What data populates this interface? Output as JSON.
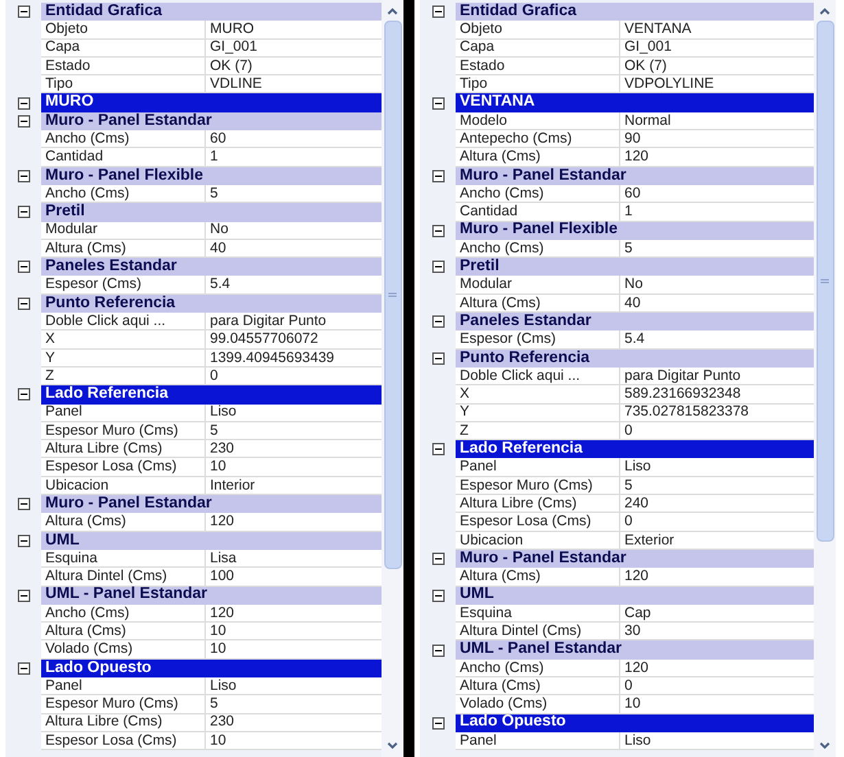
{
  "panels": [
    {
      "rows": [
        {
          "kind": "category",
          "label": "Entidad Grafica",
          "expanded": true,
          "highlighted": false
        },
        {
          "kind": "property",
          "name": "Objeto",
          "value": "MURO"
        },
        {
          "kind": "property",
          "name": "Capa",
          "value": "GI_001"
        },
        {
          "kind": "property",
          "name": "Estado",
          "value": "OK (7)"
        },
        {
          "kind": "property",
          "name": "Tipo",
          "value": "VDLINE"
        },
        {
          "kind": "category",
          "label": "MURO",
          "expanded": true,
          "highlighted": true
        },
        {
          "kind": "category",
          "label": "Muro - Panel Estandar",
          "expanded": true,
          "highlighted": false
        },
        {
          "kind": "property",
          "name": "Ancho (Cms)",
          "value": "60"
        },
        {
          "kind": "property",
          "name": "Cantidad",
          "value": "1"
        },
        {
          "kind": "category",
          "label": "Muro - Panel Flexible",
          "expanded": true,
          "highlighted": false
        },
        {
          "kind": "property",
          "name": "Ancho (Cms)",
          "value": "5"
        },
        {
          "kind": "category",
          "label": "Pretil",
          "expanded": true,
          "highlighted": false
        },
        {
          "kind": "property",
          "name": "Modular",
          "value": "No"
        },
        {
          "kind": "property",
          "name": "Altura (Cms)",
          "value": "40"
        },
        {
          "kind": "category",
          "label": "Paneles Estandar",
          "expanded": true,
          "highlighted": false
        },
        {
          "kind": "property",
          "name": "Espesor (Cms)",
          "value": "5.4"
        },
        {
          "kind": "category",
          "label": "Punto Referencia",
          "expanded": true,
          "highlighted": false
        },
        {
          "kind": "property",
          "name": "Doble Click aqui ...",
          "value": "para Digitar Punto"
        },
        {
          "kind": "property",
          "name": "X",
          "value": "99.04557706072"
        },
        {
          "kind": "property",
          "name": "Y",
          "value": "1399.40945693439"
        },
        {
          "kind": "property",
          "name": "Z",
          "value": "0"
        },
        {
          "kind": "category",
          "label": "Lado Referencia",
          "expanded": true,
          "highlighted": true
        },
        {
          "kind": "property",
          "name": "Panel",
          "value": "Liso"
        },
        {
          "kind": "property",
          "name": "Espesor Muro (Cms)",
          "value": "5"
        },
        {
          "kind": "property",
          "name": "Altura Libre (Cms)",
          "value": "230"
        },
        {
          "kind": "property",
          "name": "Espesor Losa (Cms)",
          "value": "10"
        },
        {
          "kind": "property",
          "name": "Ubicacion",
          "value": "Interior"
        },
        {
          "kind": "category",
          "label": "Muro - Panel Estandar",
          "expanded": true,
          "highlighted": false
        },
        {
          "kind": "property",
          "name": "Altura (Cms)",
          "value": "120"
        },
        {
          "kind": "category",
          "label": "UML",
          "expanded": true,
          "highlighted": false
        },
        {
          "kind": "property",
          "name": "Esquina",
          "value": "Lisa"
        },
        {
          "kind": "property",
          "name": "Altura Dintel (Cms)",
          "value": "100"
        },
        {
          "kind": "category",
          "label": "UML - Panel Estandar",
          "expanded": true,
          "highlighted": false
        },
        {
          "kind": "property",
          "name": "Ancho (Cms)",
          "value": "120"
        },
        {
          "kind": "property",
          "name": "Altura (Cms)",
          "value": "10"
        },
        {
          "kind": "property",
          "name": "Volado (Cms)",
          "value": "10"
        },
        {
          "kind": "category",
          "label": "Lado Opuesto",
          "expanded": true,
          "highlighted": true
        },
        {
          "kind": "property",
          "name": "Panel",
          "value": "Liso"
        },
        {
          "kind": "property",
          "name": "Espesor Muro (Cms)",
          "value": "5"
        },
        {
          "kind": "property",
          "name": "Altura Libre (Cms)",
          "value": "230"
        },
        {
          "kind": "property",
          "name": "Espesor Losa (Cms)",
          "value": "10"
        }
      ]
    },
    {
      "rows": [
        {
          "kind": "category",
          "label": "Entidad Grafica",
          "expanded": true,
          "highlighted": false
        },
        {
          "kind": "property",
          "name": "Objeto",
          "value": "VENTANA"
        },
        {
          "kind": "property",
          "name": "Capa",
          "value": "GI_001"
        },
        {
          "kind": "property",
          "name": "Estado",
          "value": "OK (7)"
        },
        {
          "kind": "property",
          "name": "Tipo",
          "value": "VDPOLYLINE"
        },
        {
          "kind": "category",
          "label": "VENTANA",
          "expanded": true,
          "highlighted": true
        },
        {
          "kind": "property",
          "name": "Modelo",
          "value": "Normal"
        },
        {
          "kind": "property",
          "name": "Antepecho (Cms)",
          "value": "90"
        },
        {
          "kind": "property",
          "name": "Altura (Cms)",
          "value": "120"
        },
        {
          "kind": "category",
          "label": "Muro - Panel Estandar",
          "expanded": true,
          "highlighted": false
        },
        {
          "kind": "property",
          "name": "Ancho (Cms)",
          "value": "60"
        },
        {
          "kind": "property",
          "name": "Cantidad",
          "value": "1"
        },
        {
          "kind": "category",
          "label": "Muro - Panel Flexible",
          "expanded": true,
          "highlighted": false
        },
        {
          "kind": "property",
          "name": "Ancho (Cms)",
          "value": "5"
        },
        {
          "kind": "category",
          "label": "Pretil",
          "expanded": true,
          "highlighted": false
        },
        {
          "kind": "property",
          "name": "Modular",
          "value": "No"
        },
        {
          "kind": "property",
          "name": "Altura (Cms)",
          "value": "40"
        },
        {
          "kind": "category",
          "label": "Paneles Estandar",
          "expanded": true,
          "highlighted": false
        },
        {
          "kind": "property",
          "name": "Espesor (Cms)",
          "value": "5.4"
        },
        {
          "kind": "category",
          "label": "Punto Referencia",
          "expanded": true,
          "highlighted": false
        },
        {
          "kind": "property",
          "name": "Doble Click aqui ...",
          "value": "para Digitar Punto"
        },
        {
          "kind": "property",
          "name": "X",
          "value": "589.23166932348"
        },
        {
          "kind": "property",
          "name": "Y",
          "value": "735.027815823378"
        },
        {
          "kind": "property",
          "name": "Z",
          "value": "0"
        },
        {
          "kind": "category",
          "label": "Lado Referencia",
          "expanded": true,
          "highlighted": true
        },
        {
          "kind": "property",
          "name": "Panel",
          "value": "Liso"
        },
        {
          "kind": "property",
          "name": "Espesor Muro (Cms)",
          "value": "5"
        },
        {
          "kind": "property",
          "name": "Altura Libre (Cms)",
          "value": "240"
        },
        {
          "kind": "property",
          "name": "Espesor Losa (Cms)",
          "value": "0"
        },
        {
          "kind": "property",
          "name": "Ubicacion",
          "value": "Exterior"
        },
        {
          "kind": "category",
          "label": "Muro - Panel Estandar",
          "expanded": true,
          "highlighted": false
        },
        {
          "kind": "property",
          "name": "Altura (Cms)",
          "value": "120"
        },
        {
          "kind": "category",
          "label": "UML",
          "expanded": true,
          "highlighted": false
        },
        {
          "kind": "property",
          "name": "Esquina",
          "value": "Cap"
        },
        {
          "kind": "property",
          "name": "Altura Dintel (Cms)",
          "value": "30"
        },
        {
          "kind": "category",
          "label": "UML - Panel Estandar",
          "expanded": true,
          "highlighted": false
        },
        {
          "kind": "property",
          "name": "Ancho (Cms)",
          "value": "120"
        },
        {
          "kind": "property",
          "name": "Altura (Cms)",
          "value": "0"
        },
        {
          "kind": "property",
          "name": "Volado (Cms)",
          "value": "10"
        },
        {
          "kind": "category",
          "label": "Lado Opuesto",
          "expanded": true,
          "highlighted": true
        },
        {
          "kind": "property",
          "name": "Panel",
          "value": "Liso"
        }
      ]
    }
  ]
}
